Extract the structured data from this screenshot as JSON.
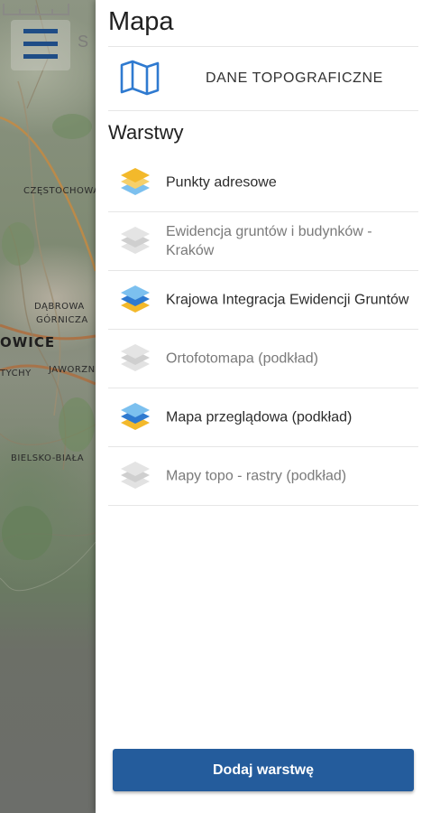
{
  "map": {
    "labels": {
      "czestochowa": "CZĘSTOCHOWA",
      "dabrowa": "DĄBROWA",
      "gornicza": "GÓRNICZA",
      "katowice": "OWICE",
      "tychy": "TYCHY",
      "jaworzno": "JAWORZNO",
      "bielsko": "BIELSKO-BIAŁA"
    },
    "search_peek": "S",
    "menu_icon": "hamburger-menu-icon"
  },
  "drawer": {
    "title": "Mapa",
    "topo": {
      "icon": "map-icon",
      "label": "DANE TOPOGRAFICZNE"
    },
    "layers_title": "Warstwy",
    "layers": [
      {
        "label": "Punkty adresowe",
        "active": true,
        "scheme": "yellow"
      },
      {
        "label": "Ewidencja gruntów i budynków - Kraków",
        "active": false,
        "scheme": "gray"
      },
      {
        "label": "Krajowa Integracja Ewidencji Gruntów",
        "active": true,
        "scheme": "blue"
      },
      {
        "label": "Ortofotomapa (podkład)",
        "active": false,
        "scheme": "gray"
      },
      {
        "label": "Mapa przeglądowa (podkład)",
        "active": true,
        "scheme": "blue"
      },
      {
        "label": "Mapy topo - rastry (podkład)",
        "active": false,
        "scheme": "gray"
      }
    ],
    "add_button": "Dodaj warstwę"
  },
  "colors": {
    "brand_blue": "#245c9c",
    "icon_blue": "#2f7ad0",
    "layer_yellow": "#f3b92b",
    "layer_lightblue": "#7cc0ef",
    "layer_gray": "#d4d4d4"
  }
}
